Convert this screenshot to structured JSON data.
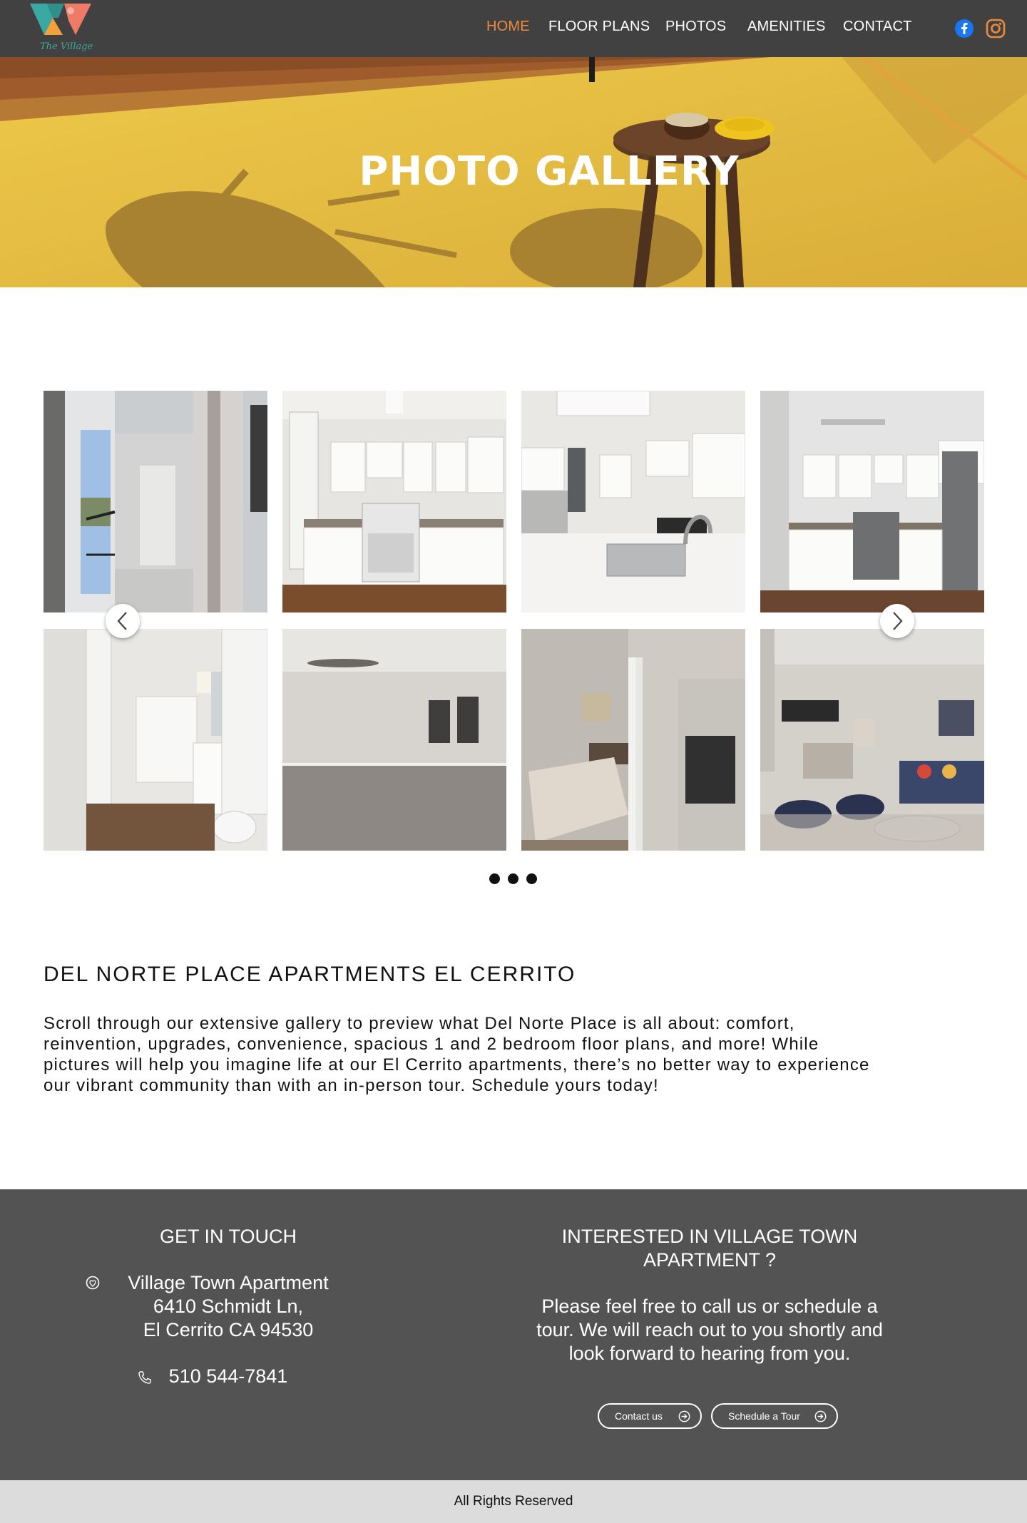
{
  "header": {
    "logo_text": "The Village",
    "nav": [
      {
        "label": "HOME",
        "active": true
      },
      {
        "label": "FLOOR PLANS",
        "active": false
      },
      {
        "label": "PHOTOS",
        "active": false
      },
      {
        "label": "AMENITIES",
        "active": false
      },
      {
        "label": "CONTACT",
        "active": false
      }
    ],
    "social_icons": [
      "facebook-icon",
      "instagram-icon"
    ],
    "accent_color": "#ef8a3d"
  },
  "hero": {
    "title": "PHOTO GALLERY"
  },
  "gallery": {
    "photos": [
      "balcony-photo",
      "kitchen-photo-1",
      "kitchen-photo-2",
      "kitchen-photo-3",
      "bathroom-photo",
      "bedroom-empty-photo",
      "bedroom-staged-photo",
      "living-room-photo"
    ],
    "arrows": [
      "chevron-left-icon",
      "chevron-right-icon"
    ],
    "dots": 3
  },
  "about": {
    "title": "DEL NORTE PLACE APARTMENTS EL CERRITO",
    "line1": "Scroll through our extensive gallery to preview what Del Norte Place is all about: comfort,",
    "line2": "reinvention, upgrades, convenience, spacious 1 and 2 bedroom floor plans, and more! While",
    "line3": "pictures will help you imagine life at our El Cerrito apartments, there’s no better way to experience",
    "line4": "our vibrant community than with an in-person tour. Schedule yours today!"
  },
  "footer": {
    "get_in_touch": "GET IN TOUCH",
    "address_name": "Village Town Apartment",
    "address_street": "6410 Schmidt Ln,",
    "address_city": "El Cerrito CA 94530",
    "phone": "510 544-7841",
    "interested_line1": "INTERESTED IN VILLAGE TOWN",
    "interested_line2": "APARTMENT ?",
    "body_line1": "Please feel free to call us or schedule a",
    "body_line2": "tour. We will reach out to you shortly and",
    "body_line3": "look forward to hearing from you.",
    "contact_button": "Contact us",
    "tour_button": "Schedule a Tour",
    "copyright": "All Rights Reserved",
    "background_color": "#535353"
  }
}
